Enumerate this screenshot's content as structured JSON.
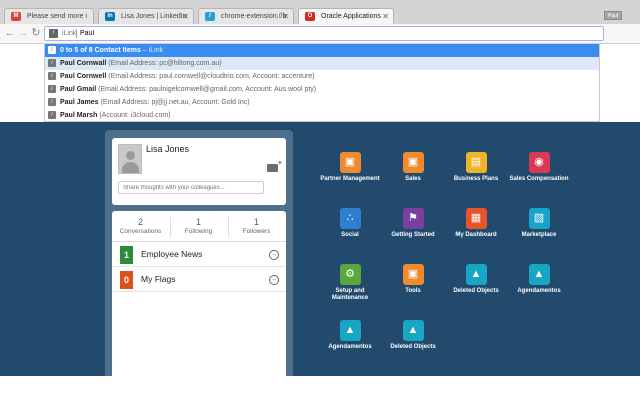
{
  "browser": {
    "tabs": [
      {
        "label": "Please send more inform",
        "favicon": "gmail-icon",
        "color": "#d44638",
        "glyph": "M"
      },
      {
        "label": "Lisa Jones | LinkedIn",
        "favicon": "linkedin-icon",
        "color": "#0077b5",
        "glyph": "in"
      },
      {
        "label": "chrome-extension://bfa…",
        "favicon": "extension-icon",
        "color": "#27a0d6",
        "glyph": "/"
      },
      {
        "label": "Oracle Applications",
        "favicon": "oracle-icon",
        "color": "#d02a22",
        "glyph": "O"
      }
    ],
    "user_chip": "Paul",
    "address": {
      "keyword": "iLink",
      "value": "Paul"
    }
  },
  "suggestions": {
    "header": {
      "label": "0 to 5 of 8 Contact Items",
      "source": "– iLink"
    },
    "items": [
      {
        "name": "Paul Cornwall",
        "detail": "(Email Address: pc@hiltong.com.au)"
      },
      {
        "name": "Paul Cornwell",
        "detail": "(Email Address: paul.cornwell@cloudtrio.com, Account: accenture)"
      },
      {
        "name": "Paul Gmail",
        "detail": "(Email Address: paulnigelcornwell@gmail.com, Account: Aus wool pty)"
      },
      {
        "name": "Paul James",
        "detail": "(Email Address: pj@jj.net.au, Account: Gold Inc)"
      },
      {
        "name": "Paul Marsh",
        "detail": "(Account: i3cloud.com)"
      }
    ]
  },
  "profile": {
    "name": "Lisa Jones",
    "share_placeholder": "Share thoughts with your colleagues...",
    "stats": [
      {
        "value": "2",
        "label": "Conversations"
      },
      {
        "value": "1",
        "label": "Following"
      },
      {
        "value": "1",
        "label": "Followers"
      }
    ],
    "flags": [
      {
        "count": "1",
        "label": "Employee News",
        "color": "#2e8b3a"
      },
      {
        "count": "0",
        "label": "My Flags",
        "color": "#d9531e"
      }
    ]
  },
  "apps": [
    {
      "label": "Partner Management",
      "icon": "partner-icon",
      "color": "#ef8a2f",
      "glyph": "▣"
    },
    {
      "label": "Sales",
      "icon": "sales-icon",
      "color": "#ef8a2f",
      "glyph": "▣"
    },
    {
      "label": "Business Plans",
      "icon": "business-plans-icon",
      "color": "#f0b429",
      "glyph": "▤"
    },
    {
      "label": "Sales Compensation",
      "icon": "sales-compensation-icon",
      "color": "#d83a52",
      "glyph": "◉"
    },
    {
      "label": "Social",
      "icon": "social-icon",
      "color": "#2f7fd1",
      "glyph": "∴"
    },
    {
      "label": "Getting Started",
      "icon": "getting-started-icon",
      "color": "#7b3fa0",
      "glyph": "⚑"
    },
    {
      "label": "My Dashboard",
      "icon": "dashboard-icon",
      "color": "#e8542a",
      "glyph": "▦"
    },
    {
      "label": "Marketplace",
      "icon": "marketplace-icon",
      "color": "#1aa3c8",
      "glyph": "▧"
    },
    {
      "label": "Setup and Maintenance",
      "icon": "setup-icon",
      "color": "#5aa83c",
      "glyph": "⚙"
    },
    {
      "label": "Tools",
      "icon": "tools-icon",
      "color": "#ef8a2f",
      "glyph": "▣"
    },
    {
      "label": "Deleted Objects",
      "icon": "deleted-objects-icon",
      "color": "#17a6c4",
      "glyph": "▲"
    },
    {
      "label": "Agendamentos",
      "icon": "agendamentos-icon",
      "color": "#17a6c4",
      "glyph": "▲"
    },
    {
      "label": "Agendamentos",
      "icon": "agendamentos-icon",
      "color": "#17a6c4",
      "glyph": "▲"
    },
    {
      "label": "Deleted Objects",
      "icon": "deleted-objects-icon",
      "color": "#17a6c4",
      "glyph": "▲"
    }
  ]
}
